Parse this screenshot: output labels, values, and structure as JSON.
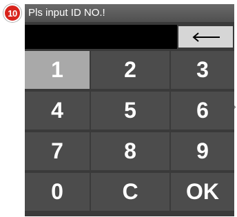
{
  "step_badge": "10",
  "dialog": {
    "title": "Pls input ID NO.!",
    "input_value": "",
    "backspace_icon": "left-arrow-icon"
  },
  "keypad": {
    "keys": [
      "1",
      "2",
      "3",
      "4",
      "5",
      "6",
      "7",
      "8",
      "9",
      "0",
      "C",
      "OK"
    ],
    "selected_key": "1"
  },
  "side_mark": "›",
  "colors": {
    "title_bar": "#5a5a5a",
    "key_normal": "#4c4c4c",
    "key_selected": "#a9a9a9",
    "display": "#000000",
    "badge": "#d8241c"
  }
}
